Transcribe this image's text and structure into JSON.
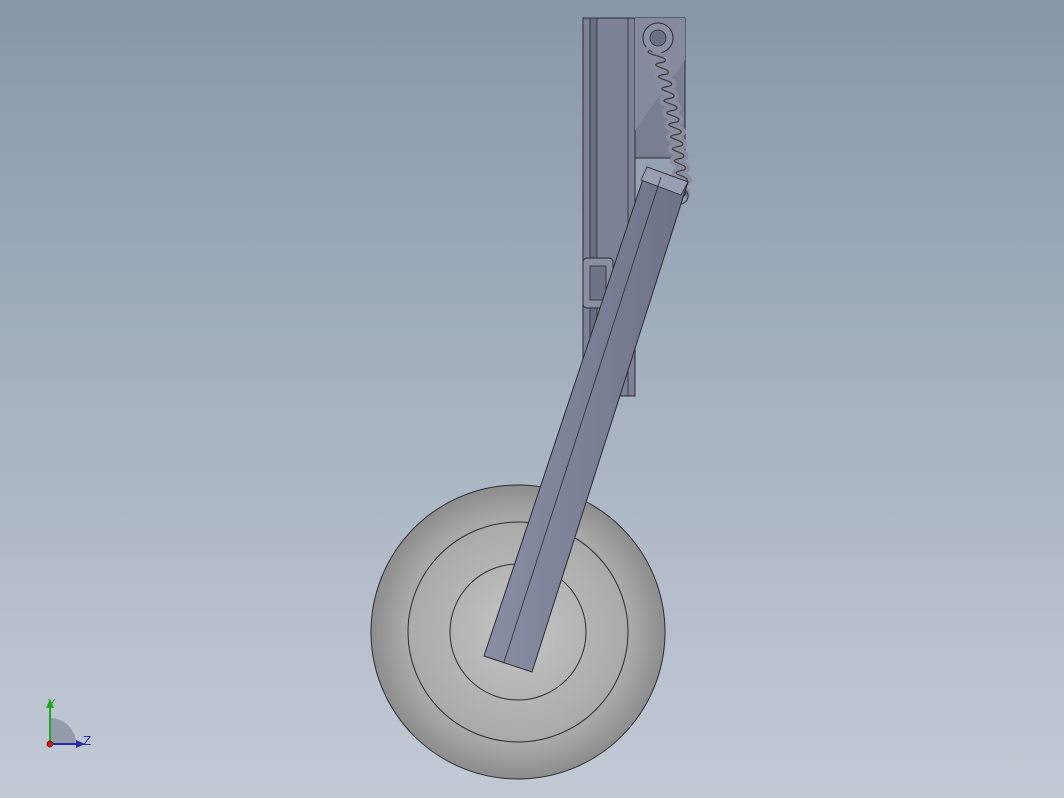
{
  "viewport": {
    "background_top": "#8797aa",
    "background_bottom": "#c3cad6"
  },
  "model": {
    "description_icon": "landing-gear-model",
    "colors": {
      "frame": "#7b7f95",
      "frame_dark": "#5b5f73",
      "strut": "#7c7f95",
      "spring": "#8a8d9d",
      "tire": "#a6a6a6",
      "rim": "#b2b2b2",
      "outline": "#2b2b33"
    }
  },
  "triad": {
    "y_label": "Y",
    "z_label": "Z",
    "y_color": "#1ea81e",
    "z_color": "#2a2aa8",
    "origin_color": "#c81e1e"
  }
}
